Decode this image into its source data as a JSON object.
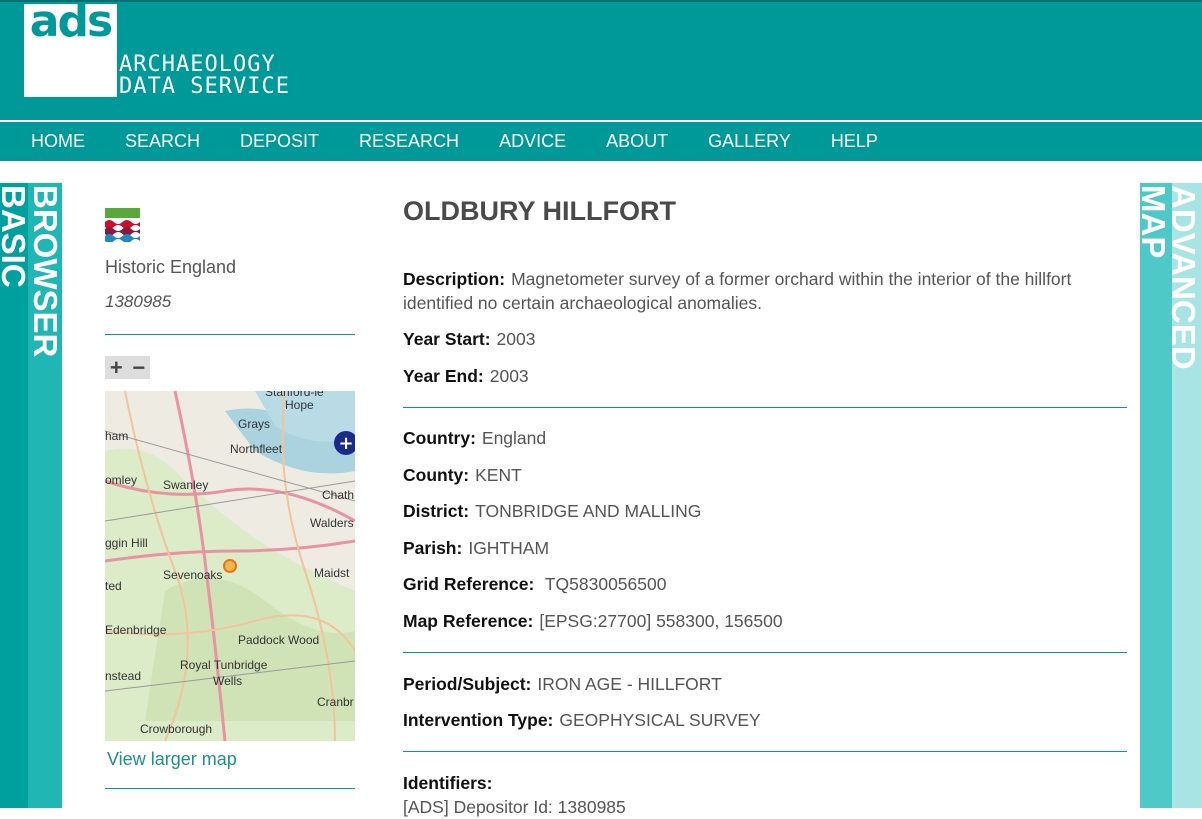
{
  "header": {
    "logo_text": "ads",
    "logo_line1": "ARCHAEOLOGY",
    "logo_line2": "DATA SERVICE"
  },
  "nav": [
    "HOME",
    "SEARCH",
    "DEPOSIT",
    "RESEARCH",
    "ADVICE",
    "ABOUT",
    "GALLERY",
    "HELP"
  ],
  "left_band": {
    "line1": "BROWSER",
    "line2": "BASIC"
  },
  "right_band": {
    "line1": "ADVANCED",
    "line2": "MAP"
  },
  "sidebar": {
    "org": "Historic England",
    "org_id": "1380985",
    "zoom_in": "+",
    "zoom_out": "−",
    "view_larger_map": "View larger map",
    "map_labels": [
      "Hope",
      "Grays",
      "ham",
      "Northfleet",
      "omley",
      "Swanley",
      "Chath",
      "Walders",
      "ggin Hill",
      "Sevenoaks",
      "Maidst",
      "ted",
      "Edenbridge",
      "Paddock Wood",
      "Royal Tunbridge",
      "Wells",
      "nstead",
      "Cranbr",
      "Crowborough",
      "Stanford-le"
    ]
  },
  "record": {
    "title": "OLDBURY HILLFORT",
    "description_label": "Description:",
    "description": "Magnetometer survey of a former orchard within the interior of the hillfort identified no certain archaeological anomalies.",
    "year_start_label": "Year Start:",
    "year_start": "2003",
    "year_end_label": "Year End:",
    "year_end": "2003",
    "country_label": "Country:",
    "country": "England",
    "county_label": "County:",
    "county": "KENT",
    "district_label": "District:",
    "district": "TONBRIDGE AND MALLING",
    "parish_label": "Parish:",
    "parish": "IGHTHAM",
    "grid_label": "Grid Reference:",
    "grid": "TQ5830056500",
    "mapref_label": "Map Reference:",
    "mapref": "[EPSG:27700] 558300, 156500",
    "period_label": "Period/Subject:",
    "period": "IRON AGE - HILLFORT",
    "intervention_label": "Intervention Type:",
    "intervention": "GEOPHYSICAL SURVEY",
    "identifiers_label": "Identifiers:",
    "identifier_1": "[ADS] Depositor Id: 1380985"
  },
  "colors": {
    "brand": "#00999a",
    "band_dark": "#00a09f",
    "band_light": "#a9e4e4"
  }
}
